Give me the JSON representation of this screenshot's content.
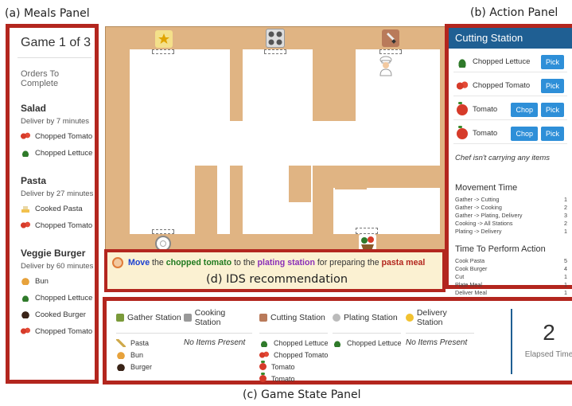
{
  "captions": {
    "meals": "(a) Meals Panel",
    "action": "(b) Action Panel",
    "gamestate": "(c) Game State Panel",
    "ids": "(d) IDS recommendation"
  },
  "meals_panel": {
    "title": "Game 1 of 3",
    "subtitle": "Orders To Complete",
    "orders": [
      {
        "name": "Salad",
        "deadline": "Deliver by 7 minutes",
        "items": [
          {
            "icon": "chopped-tomato-icon",
            "label": "Chopped Tomato"
          },
          {
            "icon": "chopped-lettuce-icon",
            "label": "Chopped Lettuce"
          }
        ]
      },
      {
        "name": "Pasta",
        "deadline": "Deliver by 27 minutes",
        "items": [
          {
            "icon": "cooked-pasta-icon",
            "label": "Cooked Pasta"
          },
          {
            "icon": "chopped-tomato-icon",
            "label": "Chopped Tomato"
          }
        ]
      },
      {
        "name": "Veggie Burger",
        "deadline": "Deliver by 60 minutes",
        "items": [
          {
            "icon": "bun-icon",
            "label": "Bun"
          },
          {
            "icon": "chopped-lettuce-icon",
            "label": "Chopped Lettuce"
          },
          {
            "icon": "cooked-burger-icon",
            "label": "Cooked Burger"
          },
          {
            "icon": "chopped-tomato-icon",
            "label": "Chopped Tomato"
          }
        ]
      }
    ]
  },
  "action_panel": {
    "header": "Cutting Station",
    "rows": [
      {
        "label": "Chopped Lettuce",
        "icon": "chopped-lettuce-icon",
        "buttons": [
          "Pick"
        ]
      },
      {
        "label": "Chopped Tomato",
        "icon": "chopped-tomato-icon",
        "buttons": [
          "Pick"
        ]
      },
      {
        "label": "Tomato",
        "icon": "tomato-icon",
        "buttons": [
          "Chop",
          "Pick"
        ]
      },
      {
        "label": "Tomato",
        "icon": "tomato-icon",
        "buttons": [
          "Chop",
          "Pick"
        ]
      }
    ],
    "carry_status": "Chef isn't carrying any items",
    "movement_title": "Movement Time",
    "movement": [
      {
        "label": "Gather -> Cutting",
        "value": "1"
      },
      {
        "label": "Gather -> Cooking",
        "value": "2"
      },
      {
        "label": "Gather -> Plating, Delivery",
        "value": "3"
      },
      {
        "label": "Cooking -> All Stations",
        "value": "2"
      },
      {
        "label": "Plating -> Delivery",
        "value": "1"
      }
    ],
    "perform_title": "Time To Perform Action",
    "perform": [
      {
        "label": "Cook Pasta",
        "value": "5"
      },
      {
        "label": "Cook Burger",
        "value": "4"
      },
      {
        "label": "Cut",
        "value": "1"
      },
      {
        "label": "Plate Meal",
        "value": "1"
      },
      {
        "label": "Deliver Meal",
        "value": "1"
      }
    ]
  },
  "ids": {
    "w1": "Move",
    "t1": " the ",
    "w2": "chopped tomato",
    "t2": " to the ",
    "w3": "plating station",
    "t3": " for preparing the ",
    "w4": "pasta meal",
    "colors": {
      "move": "#1a3fd1",
      "item": "#1f7a1f",
      "station": "#8a2fb8",
      "meal": "#b3261e"
    }
  },
  "game_state": {
    "stations": [
      {
        "name": "Gather Station",
        "icon": "gather-station-icon",
        "items": [
          {
            "icon": "pasta-icon",
            "label": "Pasta"
          },
          {
            "icon": "bun-icon",
            "label": "Bun"
          },
          {
            "icon": "burger-icon",
            "label": "Burger"
          }
        ],
        "empty": ""
      },
      {
        "name": "Cooking Station",
        "icon": "cooking-station-icon",
        "items": [],
        "empty": "No Items Present"
      },
      {
        "name": "Cutting Station",
        "icon": "cutting-station-icon",
        "items": [
          {
            "icon": "chopped-lettuce-icon",
            "label": "Chopped Lettuce"
          },
          {
            "icon": "chopped-tomato-icon",
            "label": "Chopped Tomato"
          },
          {
            "icon": "tomato-icon",
            "label": "Tomato"
          },
          {
            "icon": "tomato-icon",
            "label": "Tomato"
          }
        ],
        "empty": ""
      },
      {
        "name": "Plating Station",
        "icon": "plating-station-icon",
        "items": [
          {
            "icon": "chopped-lettuce-icon",
            "label": "Chopped Lettuce"
          }
        ],
        "empty": ""
      },
      {
        "name": "Delivery Station",
        "icon": "delivery-station-icon",
        "items": [],
        "empty": "No Items Present"
      }
    ],
    "elapsed_value": "2",
    "elapsed_label": "Elapsed Time"
  },
  "colors": {
    "frame": "#b3261e",
    "header_blue": "#1f5f93",
    "button_blue": "#2e8fd8",
    "counter": "#e0b483"
  }
}
